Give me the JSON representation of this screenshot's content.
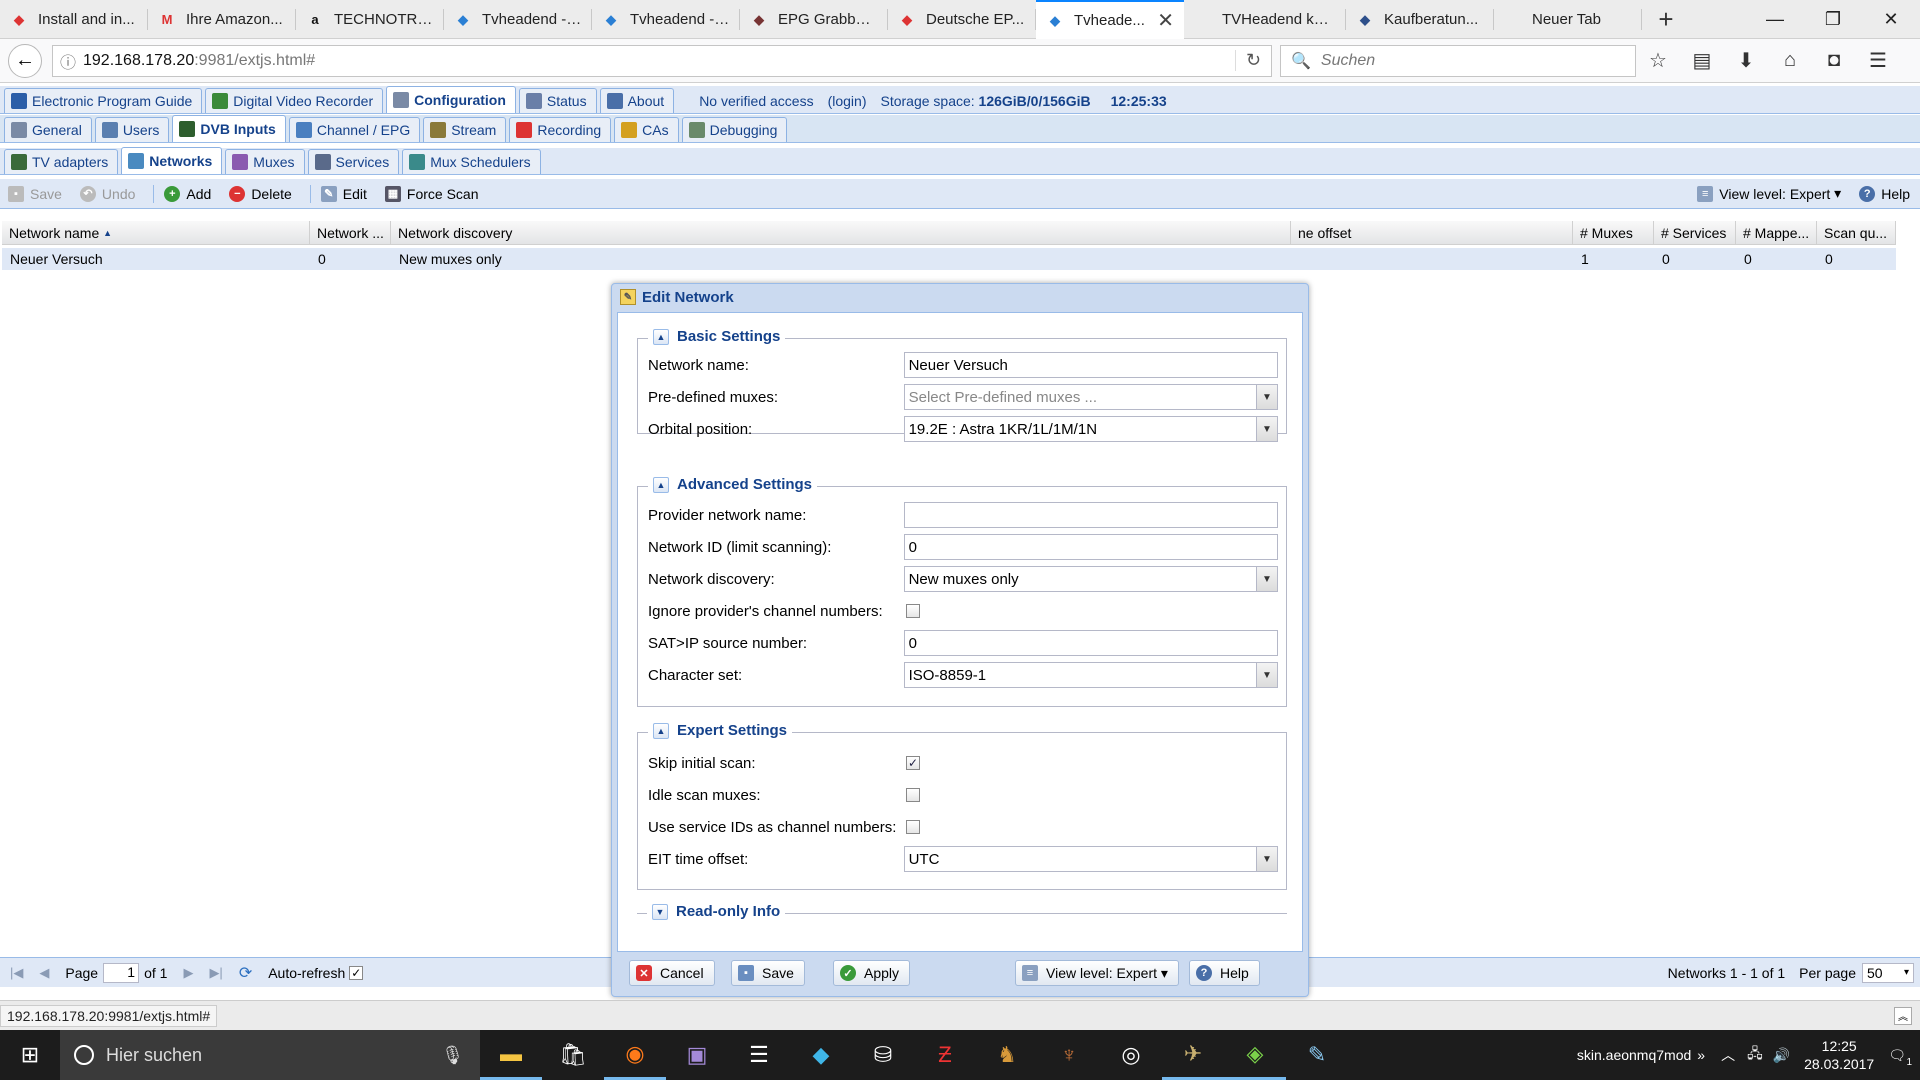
{
  "browser": {
    "tabs": [
      {
        "label": "Install and in...",
        "icon": "red-hat-icon",
        "color": "#d33"
      },
      {
        "label": "Ihre Amazon...",
        "icon": "gmail-icon",
        "color": "#d33"
      },
      {
        "label": "TECHNOTRE...",
        "icon": "amazon-icon",
        "color": "#111"
      },
      {
        "label": "Tvheadend - ...",
        "icon": "tvheadend-icon",
        "color": "#2a7fd4"
      },
      {
        "label": "Tvheadend - ...",
        "icon": "tvheadend-icon",
        "color": "#2a7fd4"
      },
      {
        "label": "EPG Grabber...",
        "icon": "bird-icon",
        "color": "#733"
      },
      {
        "label": "Deutsche EP...",
        "icon": "red-hat-icon",
        "color": "#d33"
      },
      {
        "label": "Tvheade...",
        "icon": "tvheadend-icon",
        "color": "#2a7fd4",
        "active": true
      },
      {
        "label": "TVHeadend konfi...",
        "icon": "",
        "color": ""
      },
      {
        "label": "Kaufberatun...",
        "icon": "kodi-icon",
        "color": "#2d4f8a"
      },
      {
        "label": "Neuer Tab",
        "icon": "",
        "color": ""
      }
    ],
    "url_host": "192.168.178.20",
    "url_rest": ":9981/extjs.html#",
    "search_placeholder": "Suchen"
  },
  "app": {
    "main_tabs": [
      {
        "label": "Electronic Program Guide",
        "color": "#2b5ea8"
      },
      {
        "label": "Digital Video Recorder",
        "color": "#3a8a3a"
      },
      {
        "label": "Configuration",
        "color": "#7a8aa5",
        "active": true
      },
      {
        "label": "Status",
        "color": "#6a7fa8"
      },
      {
        "label": "About",
        "color": "#4a6fa8"
      }
    ],
    "access_text": "No verified access",
    "login_text": "(login)",
    "storage_label": "Storage space:",
    "storage_value": "126GiB/0/156GiB",
    "time": "12:25:33",
    "config_tabs": [
      {
        "label": "General",
        "color": "#7a8aa5"
      },
      {
        "label": "Users",
        "color": "#5a7fb0"
      },
      {
        "label": "DVB Inputs",
        "color": "#2e5e2e",
        "active": true
      },
      {
        "label": "Channel / EPG",
        "color": "#4a7fc0"
      },
      {
        "label": "Stream",
        "color": "#8a7a3a"
      },
      {
        "label": "Recording",
        "color": "#d33"
      },
      {
        "label": "CAs",
        "color": "#d4a020"
      },
      {
        "label": "Debugging",
        "color": "#6a8a6a"
      }
    ],
    "dvb_tabs": [
      {
        "label": "TV adapters",
        "color": "#3a6a3a"
      },
      {
        "label": "Networks",
        "color": "#4a8ac0",
        "active": true
      },
      {
        "label": "Muxes",
        "color": "#8a5ab0"
      },
      {
        "label": "Services",
        "color": "#5a6a8a"
      },
      {
        "label": "Mux Schedulers",
        "color": "#3a8a8a"
      }
    ],
    "toolbar": {
      "save": "Save",
      "undo": "Undo",
      "add": "Add",
      "delete": "Delete",
      "edit": "Edit",
      "force_scan": "Force Scan",
      "view_level": "View level: Expert",
      "help": "Help"
    },
    "grid": {
      "columns": [
        "Network name",
        "Network ...",
        "Network discovery",
        "ne offset",
        "# Muxes",
        "# Services",
        "# Mappe...",
        "Scan qu..."
      ],
      "row": [
        "Neuer Versuch",
        "0",
        "New muxes only",
        "1",
        "0",
        "0",
        "0"
      ]
    },
    "paging": {
      "page_label": "Page",
      "page_value": "1",
      "of_label": "of 1",
      "auto_refresh": "Auto-refresh",
      "summary": "Networks 1 - 1 of 1",
      "per_page_label": "Per page",
      "per_page_value": "50"
    }
  },
  "modal": {
    "title": "Edit Network",
    "basic": {
      "legend": "Basic Settings",
      "network_name_label": "Network name:",
      "network_name_value": "Neuer Versuch",
      "predefined_label": "Pre-defined muxes:",
      "predefined_placeholder": "Select Pre-defined muxes ...",
      "orbital_label": "Orbital position:",
      "orbital_value": "19.2E : Astra 1KR/1L/1M/1N"
    },
    "advanced": {
      "legend": "Advanced Settings",
      "provider_label": "Provider network name:",
      "provider_value": "",
      "netid_label": "Network ID (limit scanning):",
      "netid_value": "0",
      "discovery_label": "Network discovery:",
      "discovery_value": "New muxes only",
      "ignore_label": "Ignore provider's channel numbers:",
      "ignore_checked": false,
      "satip_label": "SAT>IP source number:",
      "satip_value": "0",
      "charset_label": "Character set:",
      "charset_value": "ISO-8859-1"
    },
    "expert": {
      "legend": "Expert Settings",
      "skip_label": "Skip initial scan:",
      "skip_checked": true,
      "idle_label": "Idle scan muxes:",
      "idle_checked": false,
      "sid_label": "Use service IDs as channel numbers:",
      "sid_checked": false,
      "eit_label": "EIT time offset:",
      "eit_value": "UTC"
    },
    "readonly_legend": "Read-only Info",
    "buttons": {
      "cancel": "Cancel",
      "save": "Save",
      "apply": "Apply",
      "view_level": "View level: Expert",
      "help": "Help"
    }
  },
  "status_url": "192.168.178.20:9981/extjs.html#",
  "taskbar": {
    "search_placeholder": "Hier suchen",
    "tray_text": "skin.aeonmq7mod",
    "time": "12:25",
    "date": "28.03.2017",
    "notification_count": "1"
  }
}
